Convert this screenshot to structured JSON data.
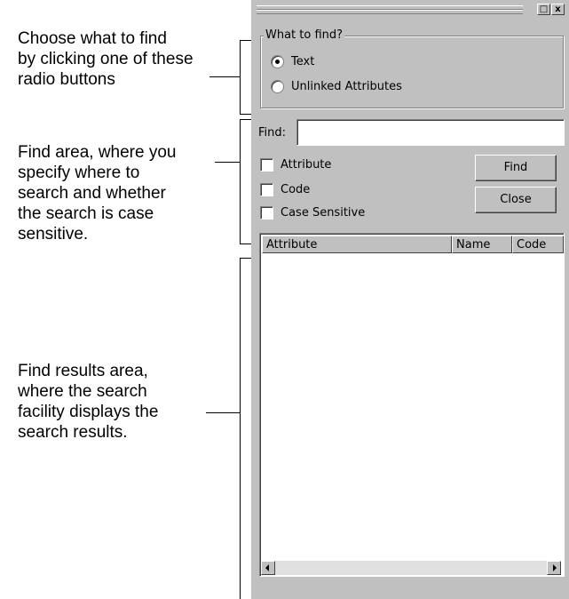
{
  "annotations": {
    "choose": [
      "Choose what to find",
      "by clicking one of these",
      "radio buttons"
    ],
    "find_area": [
      "Find area, where you",
      "specify where to",
      "search and whether",
      "the search is case",
      "sensitive."
    ],
    "results_area": [
      "Find results area,",
      "where the search",
      "facility displays the",
      "search results."
    ]
  },
  "dialog": {
    "title_buttons": {
      "restore": "□",
      "close": "x"
    },
    "what_to_find": {
      "legend": "What to find?",
      "options": [
        "Text",
        "Unlinked Attributes"
      ],
      "selected": "Text"
    },
    "find": {
      "label": "Find:",
      "value": "",
      "checkboxes": [
        "Attribute",
        "Code",
        "Case Sensitive"
      ],
      "find_button": "Find",
      "close_button": "Close"
    },
    "results": {
      "columns": [
        "Attribute",
        "Name",
        "Code"
      ]
    }
  }
}
